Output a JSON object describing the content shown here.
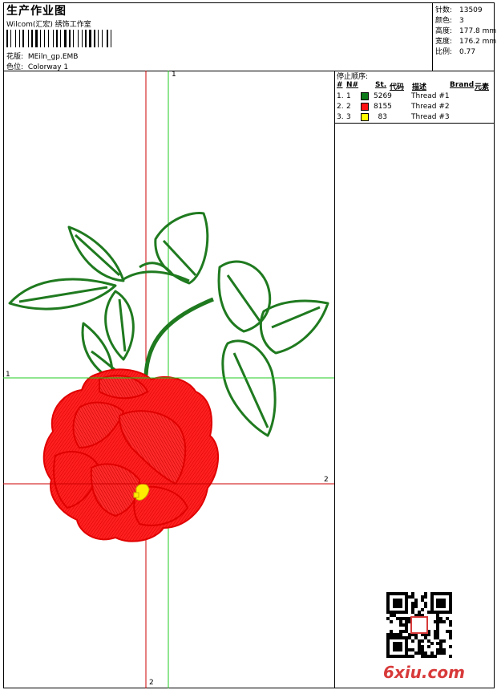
{
  "header": {
    "title": "生产作业图",
    "studio": "Wilcom(汇宏) 绣饰工作室",
    "design_key": "花版:",
    "design_value": "MEiln_gp.EMB",
    "colorway_key": "色位:",
    "colorway_value": "Colorway 1"
  },
  "stats": [
    {
      "key": "针数:",
      "value": "13509"
    },
    {
      "key": "颜色:",
      "value": "3"
    },
    {
      "key": "高度:",
      "value": "177.8 mm"
    },
    {
      "key": "宽度:",
      "value": "176.2 mm"
    },
    {
      "key": "比例:",
      "value": "0.77"
    }
  ],
  "design": {
    "v_green_label_top": "1",
    "h_green_label_left": "1",
    "h_red_label_right": "2",
    "v_red_label_bottom": "2",
    "colors": {
      "leaf": "#1f7a1f",
      "petal": "#ff1a1a",
      "center": "#ffee00",
      "guide_green": "#22cc22",
      "guide_red": "#cc0000"
    }
  },
  "stops": {
    "title": "停止顺序:",
    "headers": {
      "num": "#",
      "n": "N#",
      "st": "St.",
      "code": "代码",
      "desc": "描述",
      "brand": "Brand",
      "elem": "元素"
    },
    "rows": [
      {
        "num": "1.",
        "n": "1",
        "code": "5269",
        "desc": "Thread #1",
        "color": "#0c7a19"
      },
      {
        "num": "2.",
        "n": "2",
        "code": "8155",
        "desc": "Thread #2",
        "color": "#ff1111"
      },
      {
        "num": "3.",
        "n": "3",
        "code": "83",
        "desc": "Thread #3",
        "color": "#ffff00"
      }
    ]
  },
  "watermark": "6xiu.com"
}
